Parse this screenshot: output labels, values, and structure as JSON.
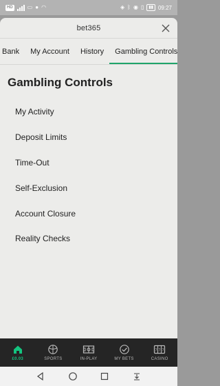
{
  "status_bar": {
    "left_chip": "HD",
    "time": "09:27"
  },
  "header": {
    "brand": "bet365"
  },
  "tabs": [
    {
      "label": "Bank"
    },
    {
      "label": "My Account"
    },
    {
      "label": "History"
    },
    {
      "label": "Gambling Controls"
    }
  ],
  "active_tab": "Gambling Controls",
  "page_title": "Gambling Controls",
  "menu": [
    {
      "label": "My Activity"
    },
    {
      "label": "Deposit Limits"
    },
    {
      "label": "Time-Out"
    },
    {
      "label": "Self-Exclusion"
    },
    {
      "label": "Account Closure"
    },
    {
      "label": "Reality Checks"
    }
  ],
  "bottom_nav": [
    {
      "label": "£0.03",
      "icon": "home-icon"
    },
    {
      "label": "SPORTS",
      "icon": "sports-ball-icon"
    },
    {
      "label": "IN-PLAY",
      "icon": "in-play-pitch-icon"
    },
    {
      "label": "MY BETS",
      "icon": "check-circle-icon"
    },
    {
      "label": "CASINO",
      "icon": "slot-machine-icon"
    }
  ],
  "colors": {
    "accent": "#1fa46a",
    "nav_active": "#14c47f",
    "nav_bg": "#252525",
    "sheet_bg": "#ececea"
  }
}
